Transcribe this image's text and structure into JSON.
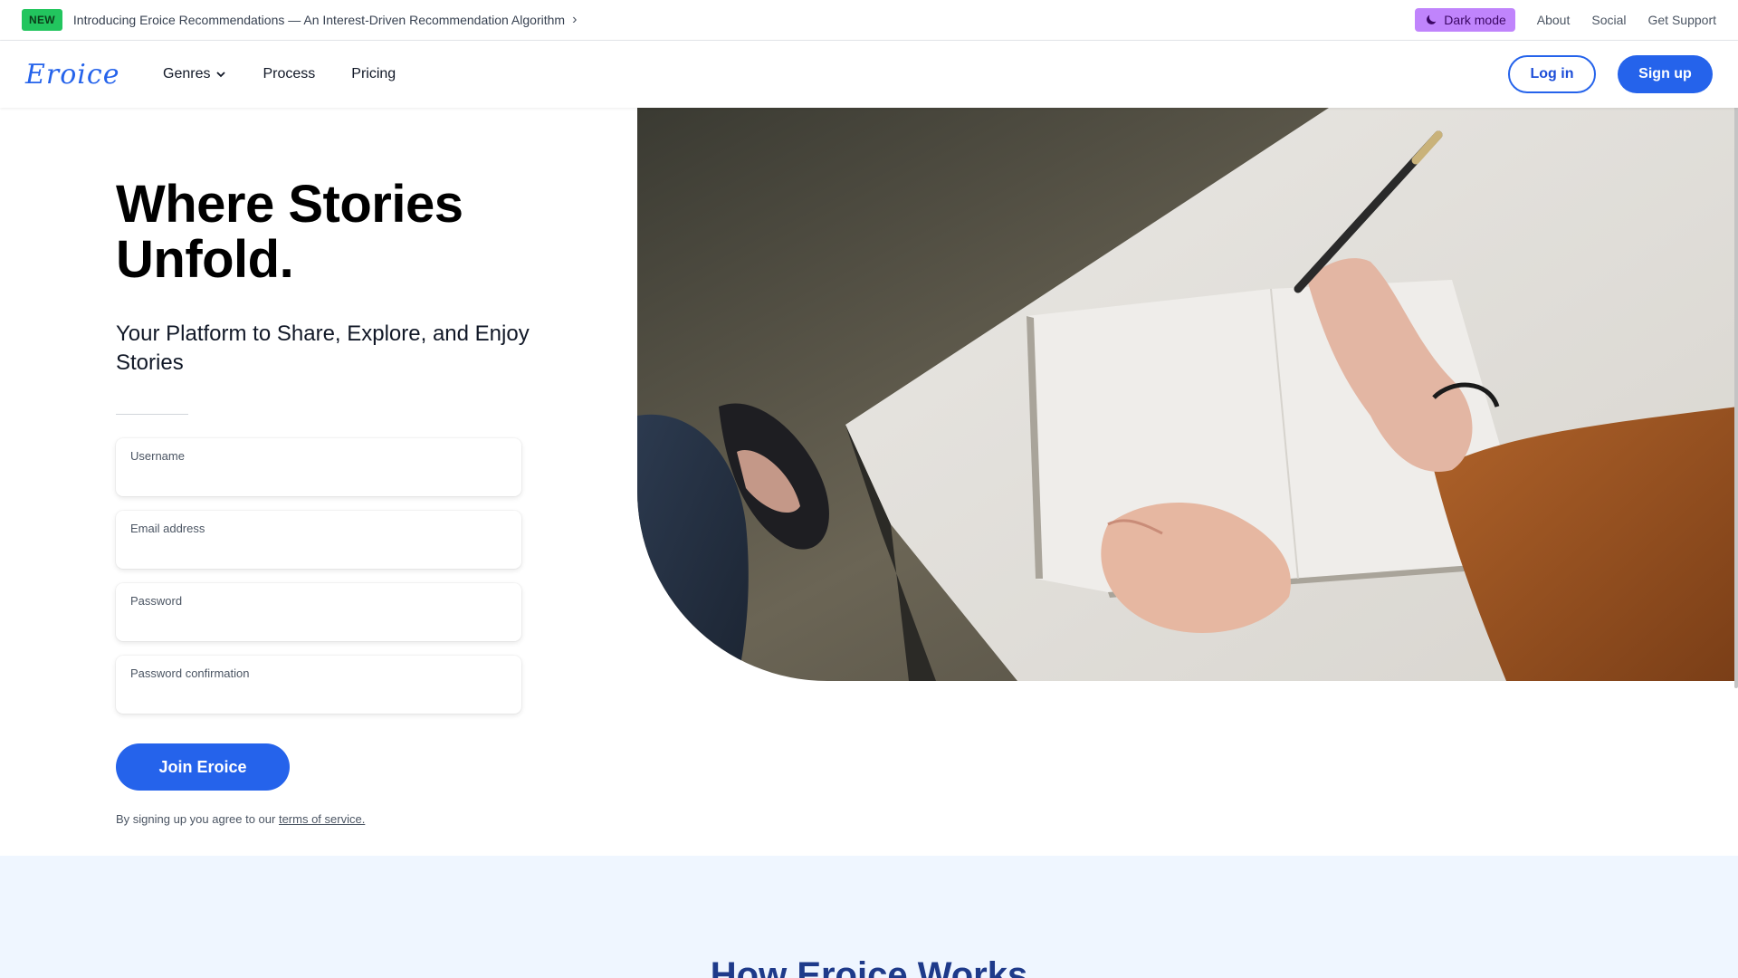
{
  "announcement": {
    "badge": "NEW",
    "text": "Introducing Eroice Recommendations — An Interest-Driven Recommendation Algorithm",
    "links": {
      "dark_mode": "Dark mode",
      "about": "About",
      "social": "Social",
      "support": "Get Support"
    }
  },
  "nav": {
    "logo": "Eroice",
    "menu": {
      "genres": "Genres",
      "process": "Process",
      "pricing": "Pricing"
    },
    "login": "Log in",
    "signup": "Sign up"
  },
  "hero": {
    "title_line1": "Where Stories",
    "title_line2": "Unfold.",
    "subtitle": "Your Platform to Share, Explore, and Enjoy Stories",
    "fields": {
      "username": {
        "label": "Username",
        "value": ""
      },
      "email": {
        "label": "Email address",
        "value": ""
      },
      "password": {
        "label": "Password",
        "value": ""
      },
      "password_confirmation": {
        "label": "Password confirmation",
        "value": ""
      }
    },
    "join_button": "Join Eroice",
    "terms_prefix": "By signing up you agree to our",
    "terms_link": "terms of service."
  },
  "how": {
    "title": "How Eroice Works"
  },
  "colors": {
    "accent": "#2563eb",
    "badge": "#22c55e",
    "dark_mode_button": "#c084fc",
    "section_bg": "#eff6ff"
  },
  "icons": {
    "announce_arrow": "chevron-right-icon",
    "dark_mode": "moon-icon",
    "genres_dropdown": "chevron-down-icon"
  }
}
